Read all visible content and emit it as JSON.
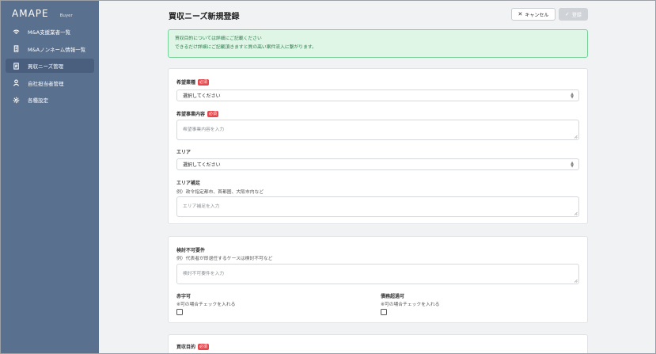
{
  "sidebar": {
    "brand": "AMAPE",
    "brand_sub": "Buyer",
    "items": [
      {
        "label": "M&A支援業者一覧",
        "icon": "wifi-icon"
      },
      {
        "label": "M&Aノンネーム情報一覧",
        "icon": "building-icon"
      },
      {
        "label": "買収ニーズ管理",
        "icon": "document-icon",
        "active": true
      },
      {
        "label": "自社担当者管理",
        "icon": "user-icon"
      },
      {
        "label": "各種設定",
        "icon": "gear-icon"
      }
    ]
  },
  "header": {
    "title": "買収ニーズ新規登録",
    "cancel_label": "キャンセル",
    "register_label": "登録"
  },
  "notice": {
    "line1": "買収目的については詳細にご記載ください",
    "line2": "できるだけ詳細にご記載頂きますと質の高い案件流入に繋がります。"
  },
  "form": {
    "desired_industry": {
      "label": "希望業種",
      "required": "必須",
      "value": "選択してください"
    },
    "desired_business": {
      "label": "希望事業内容",
      "required": "必須",
      "placeholder": "希望事業内容を入力"
    },
    "area": {
      "label": "エリア",
      "value": "選択してください"
    },
    "area_supplement": {
      "label": "エリア補足",
      "hint": "例）政令指定都市、首都圏、大阪市内など",
      "placeholder": "エリア補足を入力"
    },
    "not_acceptable": {
      "label": "検討不可要件",
      "hint": "例）代表者が即退任するケースは検討不可など",
      "placeholder": "検討不可要件を入力"
    },
    "deficit_ok": {
      "label": "赤字可",
      "hint": "※可の場合チェックを入れる"
    },
    "excess_debt_ok": {
      "label": "債務超過可",
      "hint": "※可の場合チェックを入れる"
    },
    "purpose": {
      "label": "買収目的",
      "required": "必須"
    }
  },
  "colors": {
    "sidebar": "#5a708f",
    "sidebar_active": "#4a5f7e",
    "required_badge": "#e5484d",
    "notice_bg": "#dff5e6",
    "notice_border": "#78d29a"
  }
}
